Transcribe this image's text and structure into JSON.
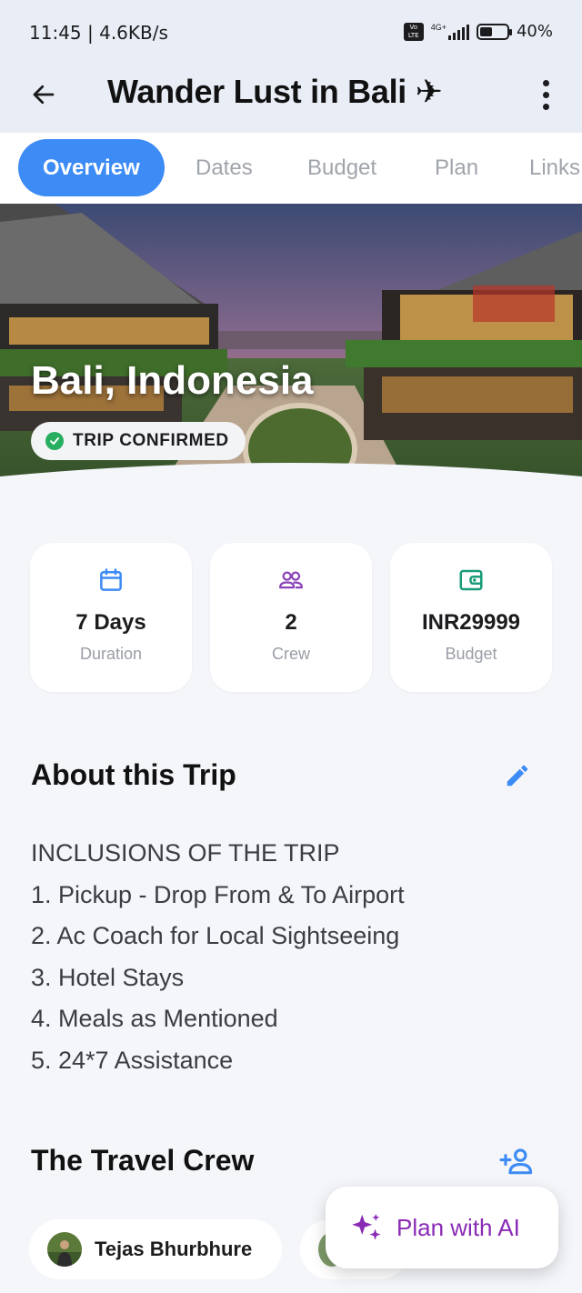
{
  "status_bar": {
    "time_speed": "11:45 | 4.6KB/s",
    "volte": "Vo LTE",
    "network": "4G+",
    "battery": "40%"
  },
  "app_bar": {
    "title": "Wander Lust in Bali ✈",
    "back_icon": "arrow-left-icon",
    "more_icon": "more-vertical-icon"
  },
  "tabs": [
    {
      "label": "Overview",
      "active": true
    },
    {
      "label": "Dates",
      "active": false
    },
    {
      "label": "Budget",
      "active": false
    },
    {
      "label": "Plan",
      "active": false
    },
    {
      "label": "Links",
      "active": false
    }
  ],
  "hero": {
    "destination": "Bali, Indonesia",
    "status_badge": "TRIP CONFIRMED",
    "status_color": "#27ae60"
  },
  "stats": [
    {
      "icon": "calendar-icon",
      "value": "7 Days",
      "label": "Duration",
      "color": "#3d8bf5"
    },
    {
      "icon": "people-icon",
      "value": "2",
      "label": "Crew",
      "color": "#8a44b8"
    },
    {
      "icon": "wallet-icon",
      "value": "INR29999",
      "label": "Budget",
      "color": "#1a9c7a"
    }
  ],
  "about": {
    "title": "About this Trip",
    "edit_icon": "pencil-icon",
    "lines": [
      "INCLUSIONS OF THE TRIP",
      "1. Pickup - Drop From & To Airport",
      "2. Ac Coach for Local Sightseeing",
      "3. Hotel Stays",
      "4. Meals as Mentioned",
      "5. 24*7 Assistance"
    ]
  },
  "crew": {
    "title": "The Travel Crew",
    "add_icon": "add-person-icon",
    "members": [
      {
        "name": "Tejas Bhurbhure"
      }
    ]
  },
  "fab": {
    "label": "Plan with AI",
    "icon": "sparkles-icon",
    "color": "#8a2bb5"
  },
  "colors": {
    "accent": "#3d8bf5",
    "header_bg": "#e9eef6",
    "page_bg": "#f4f6fa"
  }
}
